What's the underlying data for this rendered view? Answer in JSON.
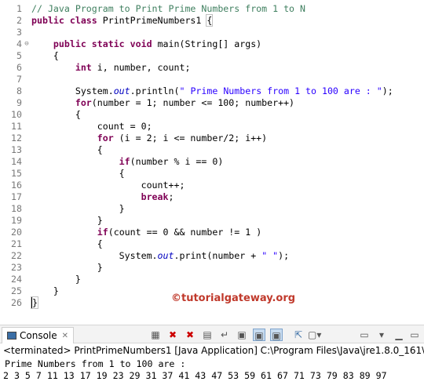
{
  "editor": {
    "lines": [
      {
        "n": "1",
        "tokens": [
          {
            "t": "// Java Program to Print Prime Numbers from 1 to N",
            "c": "cm"
          }
        ]
      },
      {
        "n": "2",
        "tokens": [
          {
            "t": "public class",
            "c": "kw"
          },
          {
            "t": " PrintPrimeNumbers1 ",
            "c": "ty"
          },
          {
            "t": "{",
            "c": "brace"
          }
        ]
      },
      {
        "n": "3",
        "tokens": []
      },
      {
        "n": "4",
        "fold": "⊖",
        "tokens": [
          {
            "t": "    public static void",
            "c": "kw"
          },
          {
            "t": " main(String[] args)",
            "c": "ty"
          }
        ]
      },
      {
        "n": "5",
        "tokens": [
          {
            "t": "    {",
            "c": "ty"
          }
        ]
      },
      {
        "n": "6",
        "tokens": [
          {
            "t": "        int",
            "c": "kw"
          },
          {
            "t": " i, number, count;",
            "c": "ty"
          }
        ]
      },
      {
        "n": "7",
        "tokens": []
      },
      {
        "n": "8",
        "tokens": [
          {
            "t": "        System.",
            "c": "ty"
          },
          {
            "t": "out",
            "c": "fd"
          },
          {
            "t": ".println(",
            "c": "ty"
          },
          {
            "t": "\" Prime Numbers from 1 to 100 are : \"",
            "c": "st"
          },
          {
            "t": ");",
            "c": "ty"
          }
        ]
      },
      {
        "n": "9",
        "tokens": [
          {
            "t": "        for",
            "c": "kw"
          },
          {
            "t": "(number = 1; number <= 100; number++)",
            "c": "ty"
          }
        ]
      },
      {
        "n": "10",
        "tokens": [
          {
            "t": "        {",
            "c": "ty"
          }
        ]
      },
      {
        "n": "11",
        "tokens": [
          {
            "t": "            count = 0;",
            "c": "ty"
          }
        ]
      },
      {
        "n": "12",
        "tokens": [
          {
            "t": "            for",
            "c": "kw"
          },
          {
            "t": " (i = 2; i <= number/2; i++)",
            "c": "ty"
          }
        ]
      },
      {
        "n": "13",
        "tokens": [
          {
            "t": "            {",
            "c": "ty"
          }
        ]
      },
      {
        "n": "14",
        "tokens": [
          {
            "t": "                if",
            "c": "kw"
          },
          {
            "t": "(number % i == 0)",
            "c": "ty"
          }
        ]
      },
      {
        "n": "15",
        "tokens": [
          {
            "t": "                {",
            "c": "ty"
          }
        ]
      },
      {
        "n": "16",
        "tokens": [
          {
            "t": "                    count++;",
            "c": "ty"
          }
        ]
      },
      {
        "n": "17",
        "tokens": [
          {
            "t": "                    break",
            "c": "kw"
          },
          {
            "t": ";",
            "c": "ty"
          }
        ]
      },
      {
        "n": "18",
        "tokens": [
          {
            "t": "                }",
            "c": "ty"
          }
        ]
      },
      {
        "n": "19",
        "tokens": [
          {
            "t": "            }",
            "c": "ty"
          }
        ]
      },
      {
        "n": "20",
        "tokens": [
          {
            "t": "            if",
            "c": "kw"
          },
          {
            "t": "(count == 0 && number != 1 )",
            "c": "ty"
          }
        ]
      },
      {
        "n": "21",
        "tokens": [
          {
            "t": "            {",
            "c": "ty"
          }
        ]
      },
      {
        "n": "22",
        "tokens": [
          {
            "t": "                System.",
            "c": "ty"
          },
          {
            "t": "out",
            "c": "fd"
          },
          {
            "t": ".print(number + ",
            "c": "ty"
          },
          {
            "t": "\" \"",
            "c": "st"
          },
          {
            "t": ");",
            "c": "ty"
          }
        ]
      },
      {
        "n": "23",
        "tokens": [
          {
            "t": "            }",
            "c": "ty"
          }
        ]
      },
      {
        "n": "24",
        "tokens": [
          {
            "t": "        }",
            "c": "ty"
          }
        ]
      },
      {
        "n": "25",
        "tokens": [
          {
            "t": "    }",
            "c": "ty"
          }
        ]
      },
      {
        "n": "26",
        "tokens": [
          {
            "t": "}",
            "c": "caretbrace"
          }
        ]
      }
    ]
  },
  "watermark": "©tutorialgateway.org",
  "console": {
    "tab_label": "Console",
    "close_glyph": "✕",
    "terminated": "<terminated> PrintPrimeNumbers1 [Java Application] C:\\Program Files\\Java\\jre1.8.0_161\\bin\\javaw.e",
    "output_line1": "Prime Numbers from 1 to 100 are :",
    "output_line2": "2 3 5 7 11 13 17 19 23 29 31 37 41 43 47 53 59 61 67 71 73 79 83 89 97",
    "toolbar_icons": [
      "clear-console-icon",
      "terminate-icon",
      "remove-all-terminated-icon",
      "scroll-lock-icon",
      "word-wrap-icon",
      "show-on-stdout-icon",
      "show-on-stderr-icon",
      "pin-console-icon",
      "display-selected-console-icon",
      "open-console-icon",
      "view-menu-icon"
    ]
  }
}
